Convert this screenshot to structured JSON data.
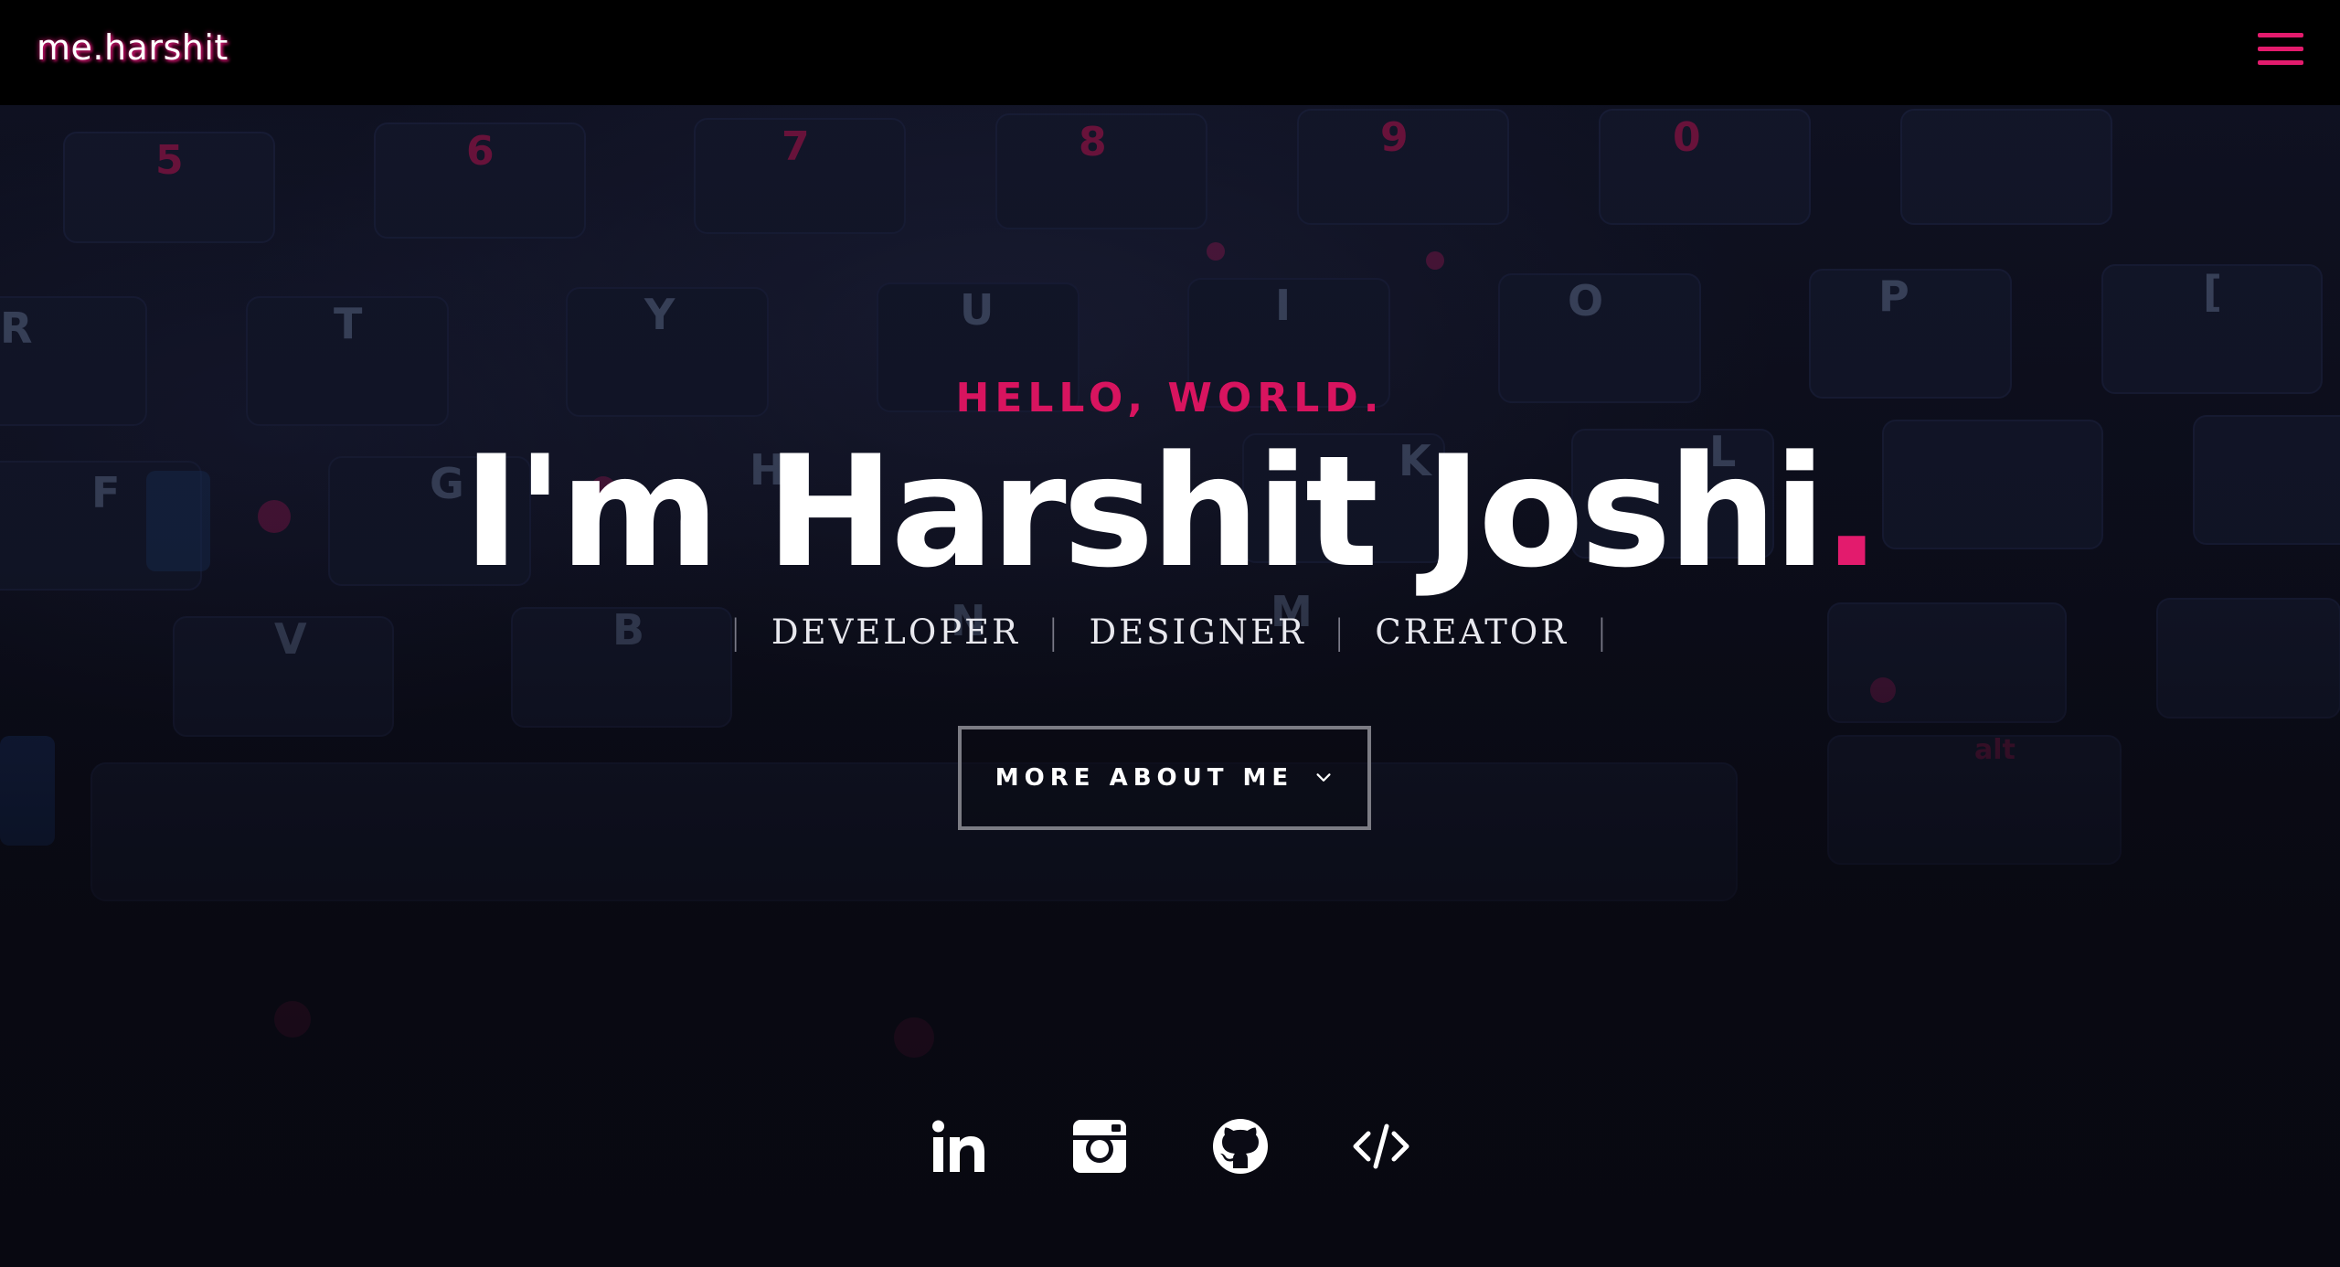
{
  "brand": {
    "label": "me.harshit"
  },
  "nav": {
    "menu_icon": "hamburger-menu-icon"
  },
  "hero": {
    "greeting": "HELLO, WORLD.",
    "name_prefix": "I'm Harshit Joshi",
    "name_period": ".",
    "roles": [
      "DEVELOPER",
      "DESIGNER",
      "CREATOR"
    ],
    "role_separator": "|",
    "cta_label": "MORE ABOUT ME",
    "cta_icon": "chevron-down-icon"
  },
  "social": [
    {
      "icon": "linkedin-icon"
    },
    {
      "icon": "instagram-icon"
    },
    {
      "icon": "github-icon"
    },
    {
      "icon": "code-icon"
    }
  ],
  "colors": {
    "accent": "#e31b6d",
    "navbar": "#000000",
    "text": "#ffffff",
    "button_border": "#7c7c84"
  },
  "keyboard_labels": [
    "5",
    "6",
    "7",
    "8",
    "9",
    "0",
    "R",
    "T",
    "Y",
    "U",
    "I",
    "O",
    "P",
    "F",
    "G",
    "H",
    "K",
    "L",
    "V",
    "B",
    "N",
    "M",
    "alt"
  ]
}
